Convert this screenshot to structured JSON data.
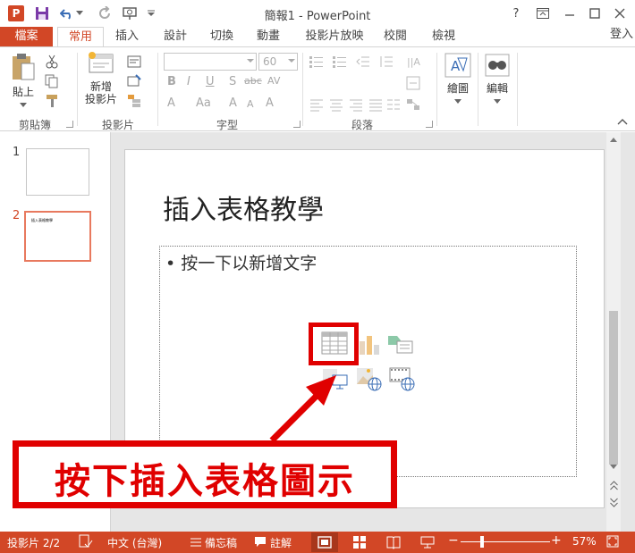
{
  "window": {
    "title": "簡報1 - PowerPoint",
    "app_logo": "P",
    "help": "?",
    "login": "登入"
  },
  "tabs": [
    {
      "label": "檔案"
    },
    {
      "label": "常用"
    },
    {
      "label": "插入"
    },
    {
      "label": "設計"
    },
    {
      "label": "切換"
    },
    {
      "label": "動畫"
    },
    {
      "label": "投影片放映"
    },
    {
      "label": "校閱"
    },
    {
      "label": "檢視"
    }
  ],
  "ribbon": {
    "clipboard": {
      "paste": "貼上",
      "group": "剪貼簿"
    },
    "slides": {
      "new_slide_line1": "新增",
      "new_slide_line2": "投影片",
      "group": "投影片"
    },
    "font": {
      "size": "60",
      "group": "字型"
    },
    "paragraph": {
      "group": "段落"
    },
    "drawing": {
      "label": "繪圖"
    },
    "editing": {
      "label": "編輯"
    }
  },
  "thumbnails": [
    {
      "number": "1",
      "text": ""
    },
    {
      "number": "2",
      "text": "插入表格教學"
    }
  ],
  "slide": {
    "title": "插入表格教學",
    "bullet": "• 按一下以新增文字"
  },
  "callout": {
    "text": "按下插入表格圖示"
  },
  "statusbar": {
    "slide_info": "投影片 2/2",
    "language": "中文 (台灣)",
    "notes": "備忘稿",
    "comments": "註解",
    "zoom": "57%"
  },
  "colors": {
    "accent": "#d24726",
    "highlight": "#e00000"
  }
}
